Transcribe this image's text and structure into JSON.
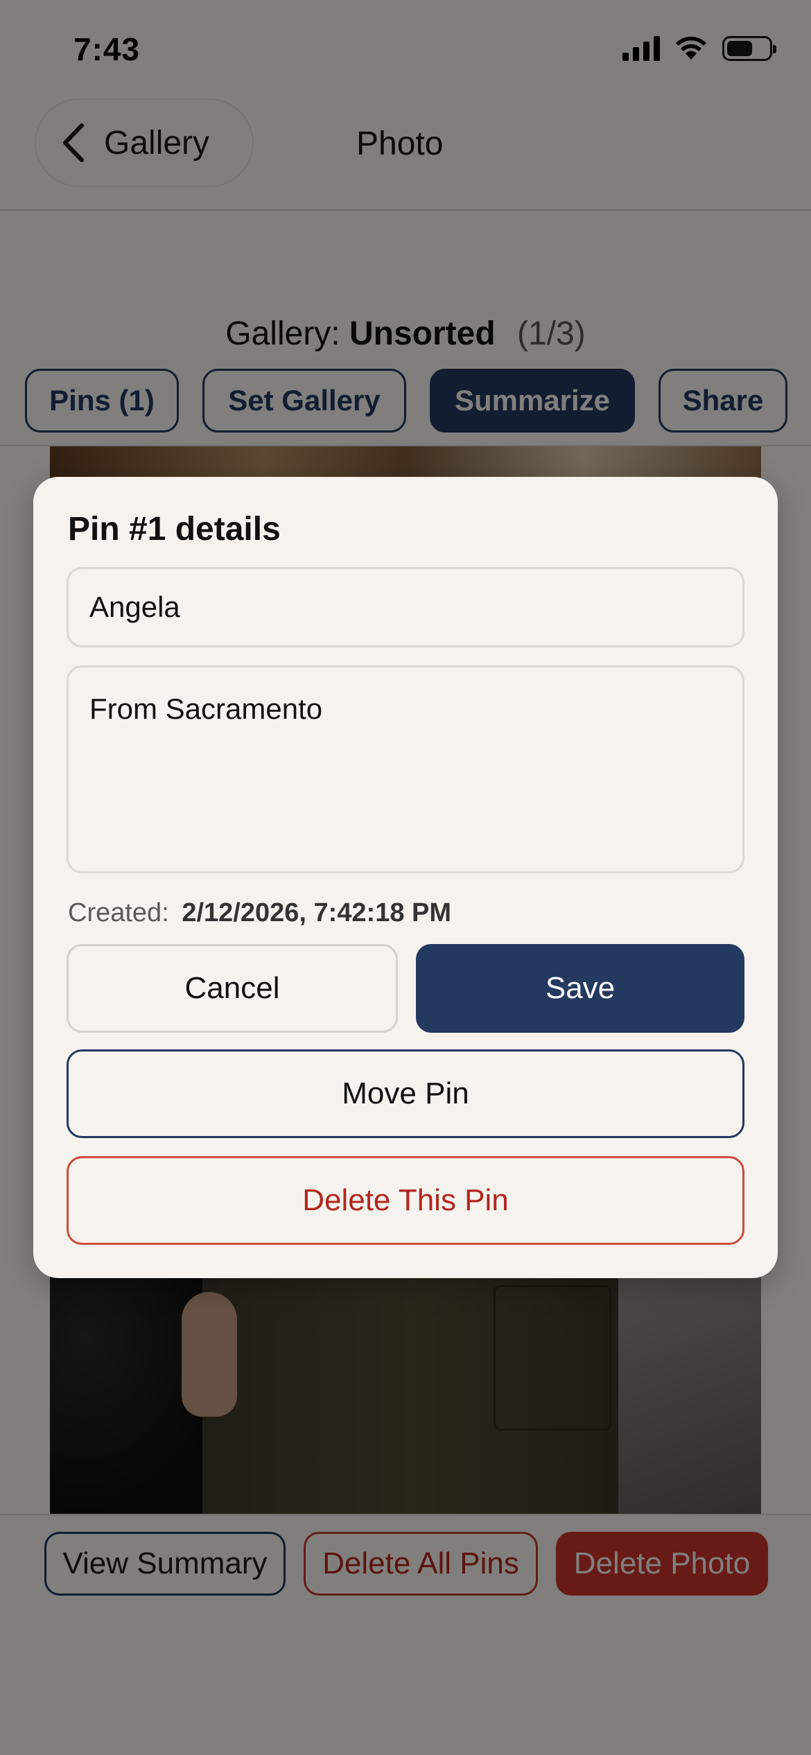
{
  "status_bar": {
    "time": "7:43",
    "icons": [
      "cellular-signal-icon",
      "wifi-icon",
      "battery-icon"
    ]
  },
  "nav": {
    "back_label": "Gallery",
    "title": "Photo"
  },
  "gallery": {
    "prefix": "Gallery:",
    "name": "Unsorted",
    "count": "(1/3)"
  },
  "toolbar": {
    "pins_label": "Pins (1)",
    "set_gallery_label": "Set Gallery",
    "summarize_label": "Summarize",
    "share_label": "Share"
  },
  "modal": {
    "title": "Pin #1 details",
    "name_value": "Angela",
    "notes_value": "From Sacramento",
    "created_label": "Created:",
    "created_value": "2/12/2026, 7:42:18 PM",
    "cancel_label": "Cancel",
    "save_label": "Save",
    "move_label": "Move Pin",
    "delete_label": "Delete This Pin"
  },
  "bottom_actions": {
    "view_summary_label": "View Summary",
    "delete_all_pins_label": "Delete All Pins",
    "delete_photo_label": "Delete Photo"
  },
  "colors": {
    "navy": "#24395f",
    "danger": "#c8352b",
    "background": "#f6f3ef"
  }
}
